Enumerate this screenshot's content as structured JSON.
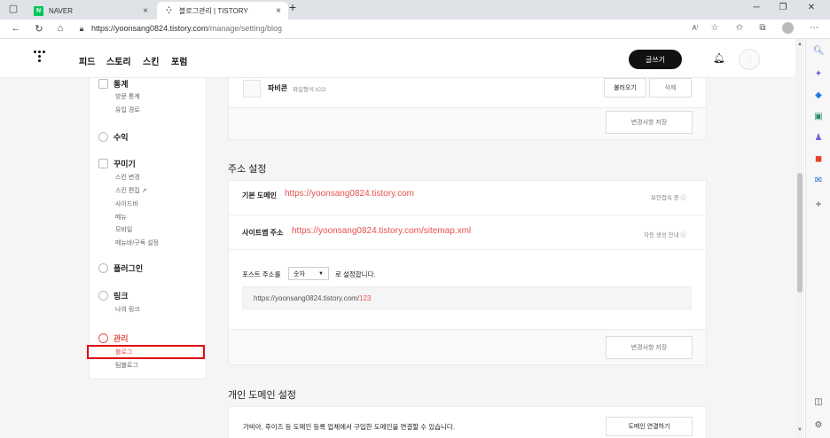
{
  "browser": {
    "tabs": [
      {
        "title": "NAVER",
        "active": false,
        "favicon": "N"
      },
      {
        "title": "블로그관리 | TISTORY",
        "active": true,
        "favicon": "tistory-logo"
      }
    ],
    "url_host": "https://yoonsang0824.tistory.com",
    "url_path": "/manage/setting/blog"
  },
  "header": {
    "menu": [
      "피드",
      "스토리",
      "스킨",
      "포럼"
    ],
    "write_label": "글쓰기"
  },
  "sidebar": {
    "groups": [
      {
        "title": "통계",
        "items": [
          "방문 통계",
          "유입 경로"
        ]
      },
      {
        "title": "수익",
        "items": []
      },
      {
        "title": "꾸미기",
        "items": [
          "스킨 변경",
          "스킨 편집 ↗",
          "사이드바",
          "메뉴",
          "모바일",
          "메뉴바/구독 설정"
        ]
      },
      {
        "title": "플러그인",
        "items": []
      },
      {
        "title": "링크",
        "items": [
          "나의 링크"
        ]
      },
      {
        "title": "관리",
        "items": [
          "블로그",
          "팀블로그"
        ]
      }
    ]
  },
  "favicon_section": {
    "label": "파비콘",
    "hint": "파일형식 ICO",
    "load_label": "불러오기",
    "delete_label": "삭제",
    "save_label": "변경사항 저장"
  },
  "address_section": {
    "title": "주소 설정",
    "default_domain_label": "기본 도메인",
    "default_domain_url": "https://yoonsang0824.tistory.com",
    "default_domain_help": "보안접속 중 ⓘ",
    "sitemap_label": "사이트맵 주소",
    "sitemap_url": "https://yoonsang0824.tistory.com/sitemap.xml",
    "sitemap_help": "자동 생성 안내 ⓘ",
    "post_address_prefix": "포스트 주소를",
    "post_address_value": "숫자",
    "post_address_suffix": "로 설정합니다.",
    "preview_base": "https://yoonsang0824.tistory.com/",
    "preview_num": "123",
    "save_label": "변경사항 저장"
  },
  "domain_section": {
    "title": "개인 도메인 설정",
    "description": "가비아, 후이즈 등 도메인 등록 업체에서 구입한 도메인을 연결할 수 있습니다.",
    "connect_label": "도메인 연결하기"
  },
  "colors": {
    "accent": "#e8514f",
    "highlight": "#e01010"
  }
}
